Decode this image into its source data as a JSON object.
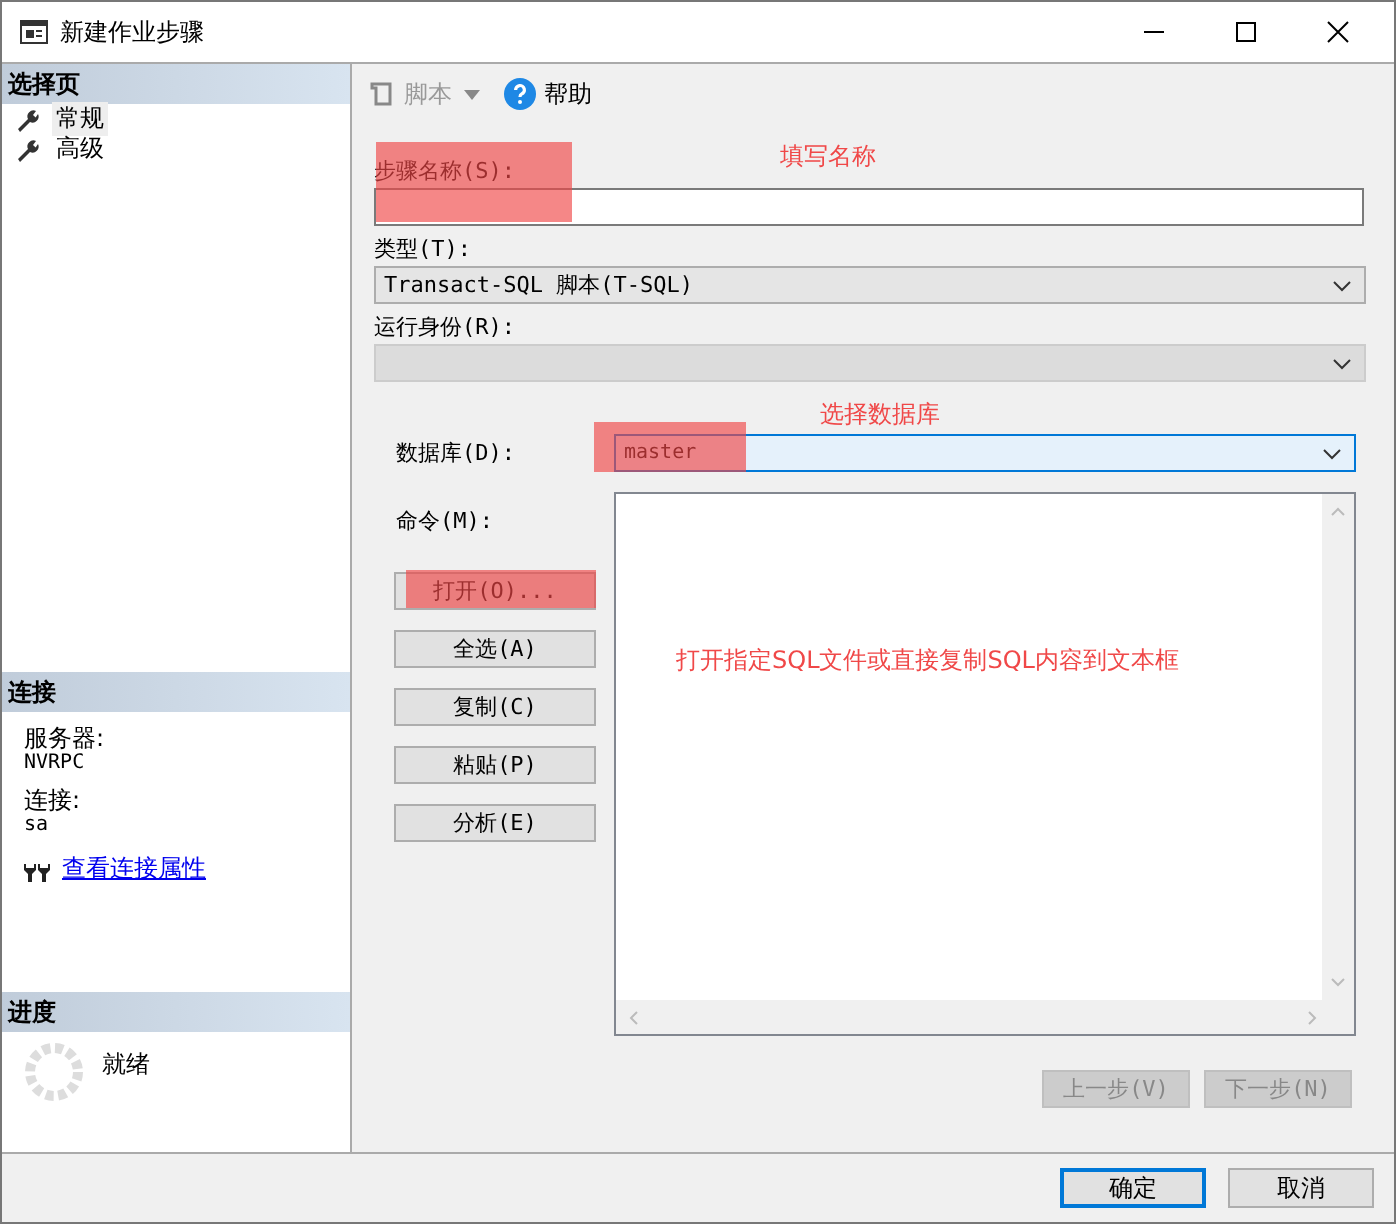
{
  "window": {
    "title": "新建作业步骤"
  },
  "sidebar": {
    "select_page": {
      "header": "选择页",
      "items": [
        {
          "label": "常规",
          "selected": true
        },
        {
          "label": "高级",
          "selected": false
        }
      ]
    },
    "connection": {
      "header": "连接",
      "fields": [
        {
          "label": "服务器:",
          "value": "NVRPC"
        },
        {
          "label": "连接:",
          "value": "sa"
        }
      ],
      "link": "查看连接属性"
    },
    "progress": {
      "header": "进度",
      "status": "就绪"
    }
  },
  "toolbar": [
    {
      "kind": "script",
      "label": "脚本",
      "disabled": true
    },
    {
      "kind": "help",
      "label": "帮助",
      "disabled": false
    }
  ],
  "form": {
    "step_name": {
      "label": "步骤名称(S):"
    },
    "type": {
      "label": "类型(T):",
      "value": "Transact-SQL 脚本(T-SQL)"
    },
    "run_as": {
      "label": "运行身份(R):",
      "disabled": true
    },
    "database": {
      "label": "数据库(D):",
      "value": "master"
    },
    "command": {
      "label": "命令(M):"
    },
    "command_buttons": [
      "打开(O)...",
      "全选(A)",
      "复制(C)",
      "粘贴(P)",
      "分析(E)"
    ],
    "nav_buttons": [
      {
        "label": "上一步(V)",
        "disabled": true
      },
      {
        "label": "下一步(N)",
        "disabled": true
      }
    ]
  },
  "annotations": [
    {
      "kind": "note",
      "text": "填写名称"
    },
    {
      "kind": "note",
      "text": "选择数据库"
    },
    {
      "kind": "note",
      "text": "打开指定SQL文件或直接复制SQL内容到文本框"
    }
  ],
  "footer_buttons": [
    {
      "label": "确定",
      "default": true
    },
    {
      "label": "取消",
      "default": false
    }
  ]
}
